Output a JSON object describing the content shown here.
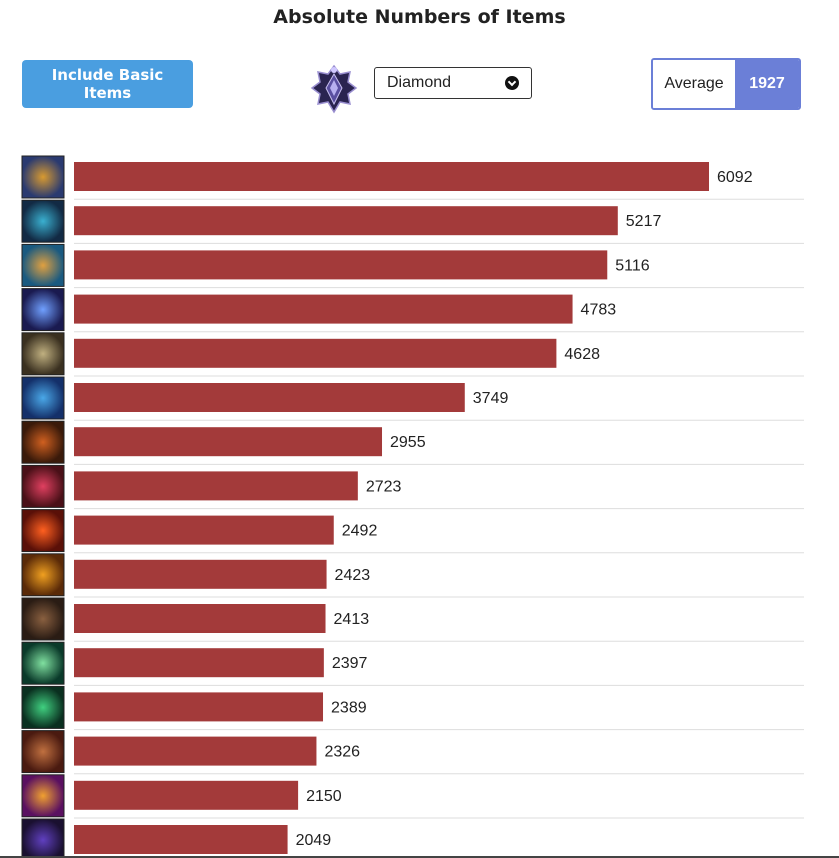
{
  "header": {
    "title": "Absolute Numbers of Items"
  },
  "controls": {
    "basic_items_label": "Include Basic Items",
    "rank_selected": "Diamond",
    "rank_emblem_icon": "diamond-rank-emblem-icon",
    "average_label": "Average",
    "average_value": "1927"
  },
  "colors": {
    "bar": "#a33a3a",
    "button": "#4a9ee0",
    "accent": "#6b7fd7"
  },
  "chart_data": {
    "type": "bar",
    "orientation": "horizontal",
    "title": "Absolute Numbers of Items",
    "values": [
      6092,
      5217,
      5116,
      4783,
      4628,
      3749,
      2955,
      2723,
      2492,
      2423,
      2413,
      2397,
      2389,
      2326,
      2150,
      2049
    ],
    "data_labels": [
      "6092",
      "5217",
      "5116",
      "4783",
      "4628",
      "3749",
      "2955",
      "2723",
      "2492",
      "2423",
      "2413",
      "2397",
      "2389",
      "2326",
      "2150",
      "2049"
    ],
    "category_icons": [
      {
        "icon": "item-icon-1",
        "colors": [
          "#2a3a70",
          "#d89a30"
        ]
      },
      {
        "icon": "item-icon-2",
        "colors": [
          "#122a44",
          "#3ab0d0"
        ]
      },
      {
        "icon": "item-icon-3",
        "colors": [
          "#1a5a80",
          "#e0a040"
        ]
      },
      {
        "icon": "item-icon-4",
        "colors": [
          "#1a1a50",
          "#70a0ff"
        ]
      },
      {
        "icon": "item-icon-5",
        "colors": [
          "#3a3020",
          "#c0b080"
        ]
      },
      {
        "icon": "item-icon-6",
        "colors": [
          "#14306a",
          "#4aa8e8"
        ]
      },
      {
        "icon": "item-icon-7",
        "colors": [
          "#3a1a0a",
          "#d06020"
        ]
      },
      {
        "icon": "item-icon-8",
        "colors": [
          "#4a1018",
          "#e04060"
        ]
      },
      {
        "icon": "item-icon-9",
        "colors": [
          "#5a1008",
          "#ff6020"
        ]
      },
      {
        "icon": "item-icon-10",
        "colors": [
          "#5a2a08",
          "#f0a020"
        ]
      },
      {
        "icon": "item-icon-11",
        "colors": [
          "#2a1c14",
          "#8a6040"
        ]
      },
      {
        "icon": "item-icon-12",
        "colors": [
          "#0a3a2a",
          "#80e0a0"
        ]
      },
      {
        "icon": "item-icon-13",
        "colors": [
          "#0a3020",
          "#40d080"
        ]
      },
      {
        "icon": "item-icon-14",
        "colors": [
          "#4a1a10",
          "#c07040"
        ]
      },
      {
        "icon": "item-icon-15",
        "colors": [
          "#5a1060",
          "#f0a030"
        ]
      },
      {
        "icon": "item-icon-16",
        "colors": [
          "#1a1030",
          "#6040c0"
        ]
      }
    ],
    "xlim": [
      0,
      7000
    ],
    "grid": true,
    "legend": "none"
  }
}
